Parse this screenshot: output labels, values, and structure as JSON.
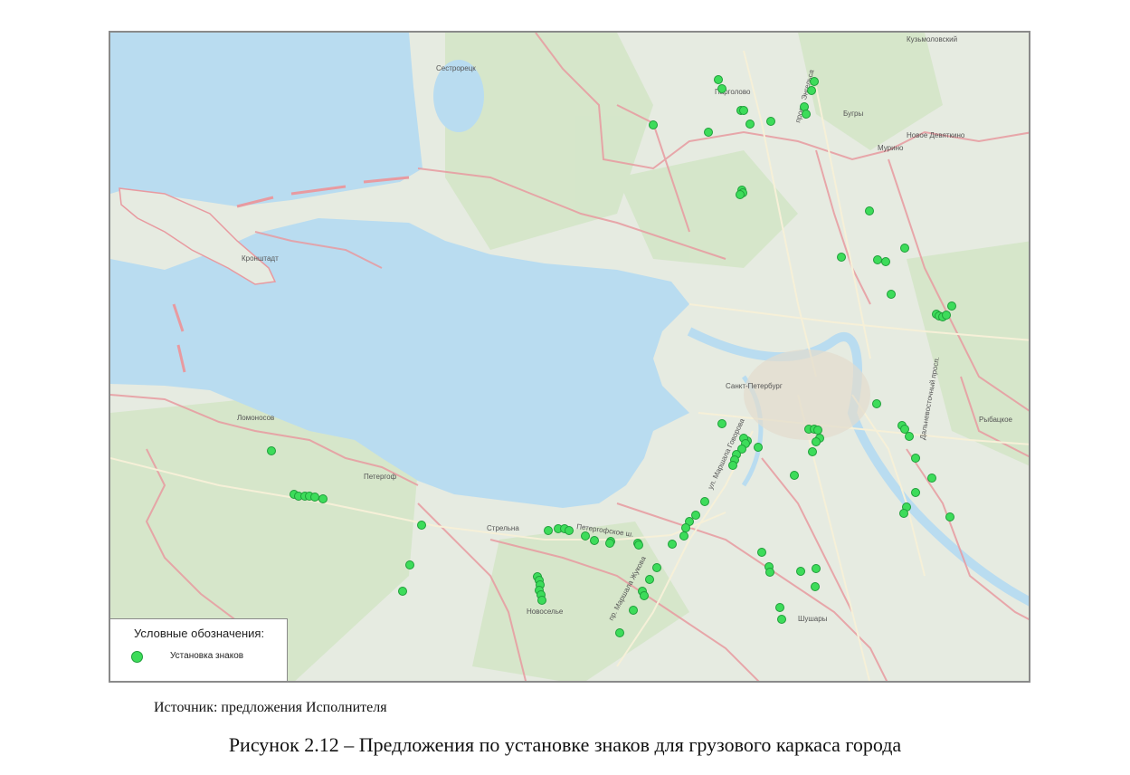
{
  "map": {
    "labels": {
      "spb": "Санкт-Петербург",
      "kronstadt": "Кронштадт",
      "sestroretsk": "Сестрорецк",
      "pargolovo": "Парголово",
      "bugry": "Бугры",
      "murino": "Мурино",
      "novoe_devyatkino": "Новое Девяткино",
      "kuzmolovsky": "Кузьмоловский",
      "lomonosov": "Ломоносов",
      "petergof": "Петергоф",
      "strelna": "Стрельна",
      "novoselye": "Новоселье",
      "shushary": "Шушары",
      "rudakovo": "Рыбацкое",
      "petergofskoe_sh": "Петергофское ш.",
      "marshala_zhukova": "пр. Маршала Жукова",
      "marshala_govorova": "ул. Маршала Говорова",
      "engelsa": "просп. Энгельса",
      "dalnevostochny": "Дальневосточный просп."
    },
    "marker_color": "#3ddc5a",
    "water_color": "#b9dcf0",
    "land_color": "#e8ece4",
    "border_color": "#e89aa0"
  },
  "legend": {
    "title": "Условные обозначения:",
    "items": [
      {
        "label": "Установка знаков",
        "color": "#3ddc5a"
      }
    ]
  },
  "source_text": "Источник: предложения Исполнителя",
  "caption": "Рисунок 2.12 – Предложения по установке знаков для грузового каркаса города"
}
